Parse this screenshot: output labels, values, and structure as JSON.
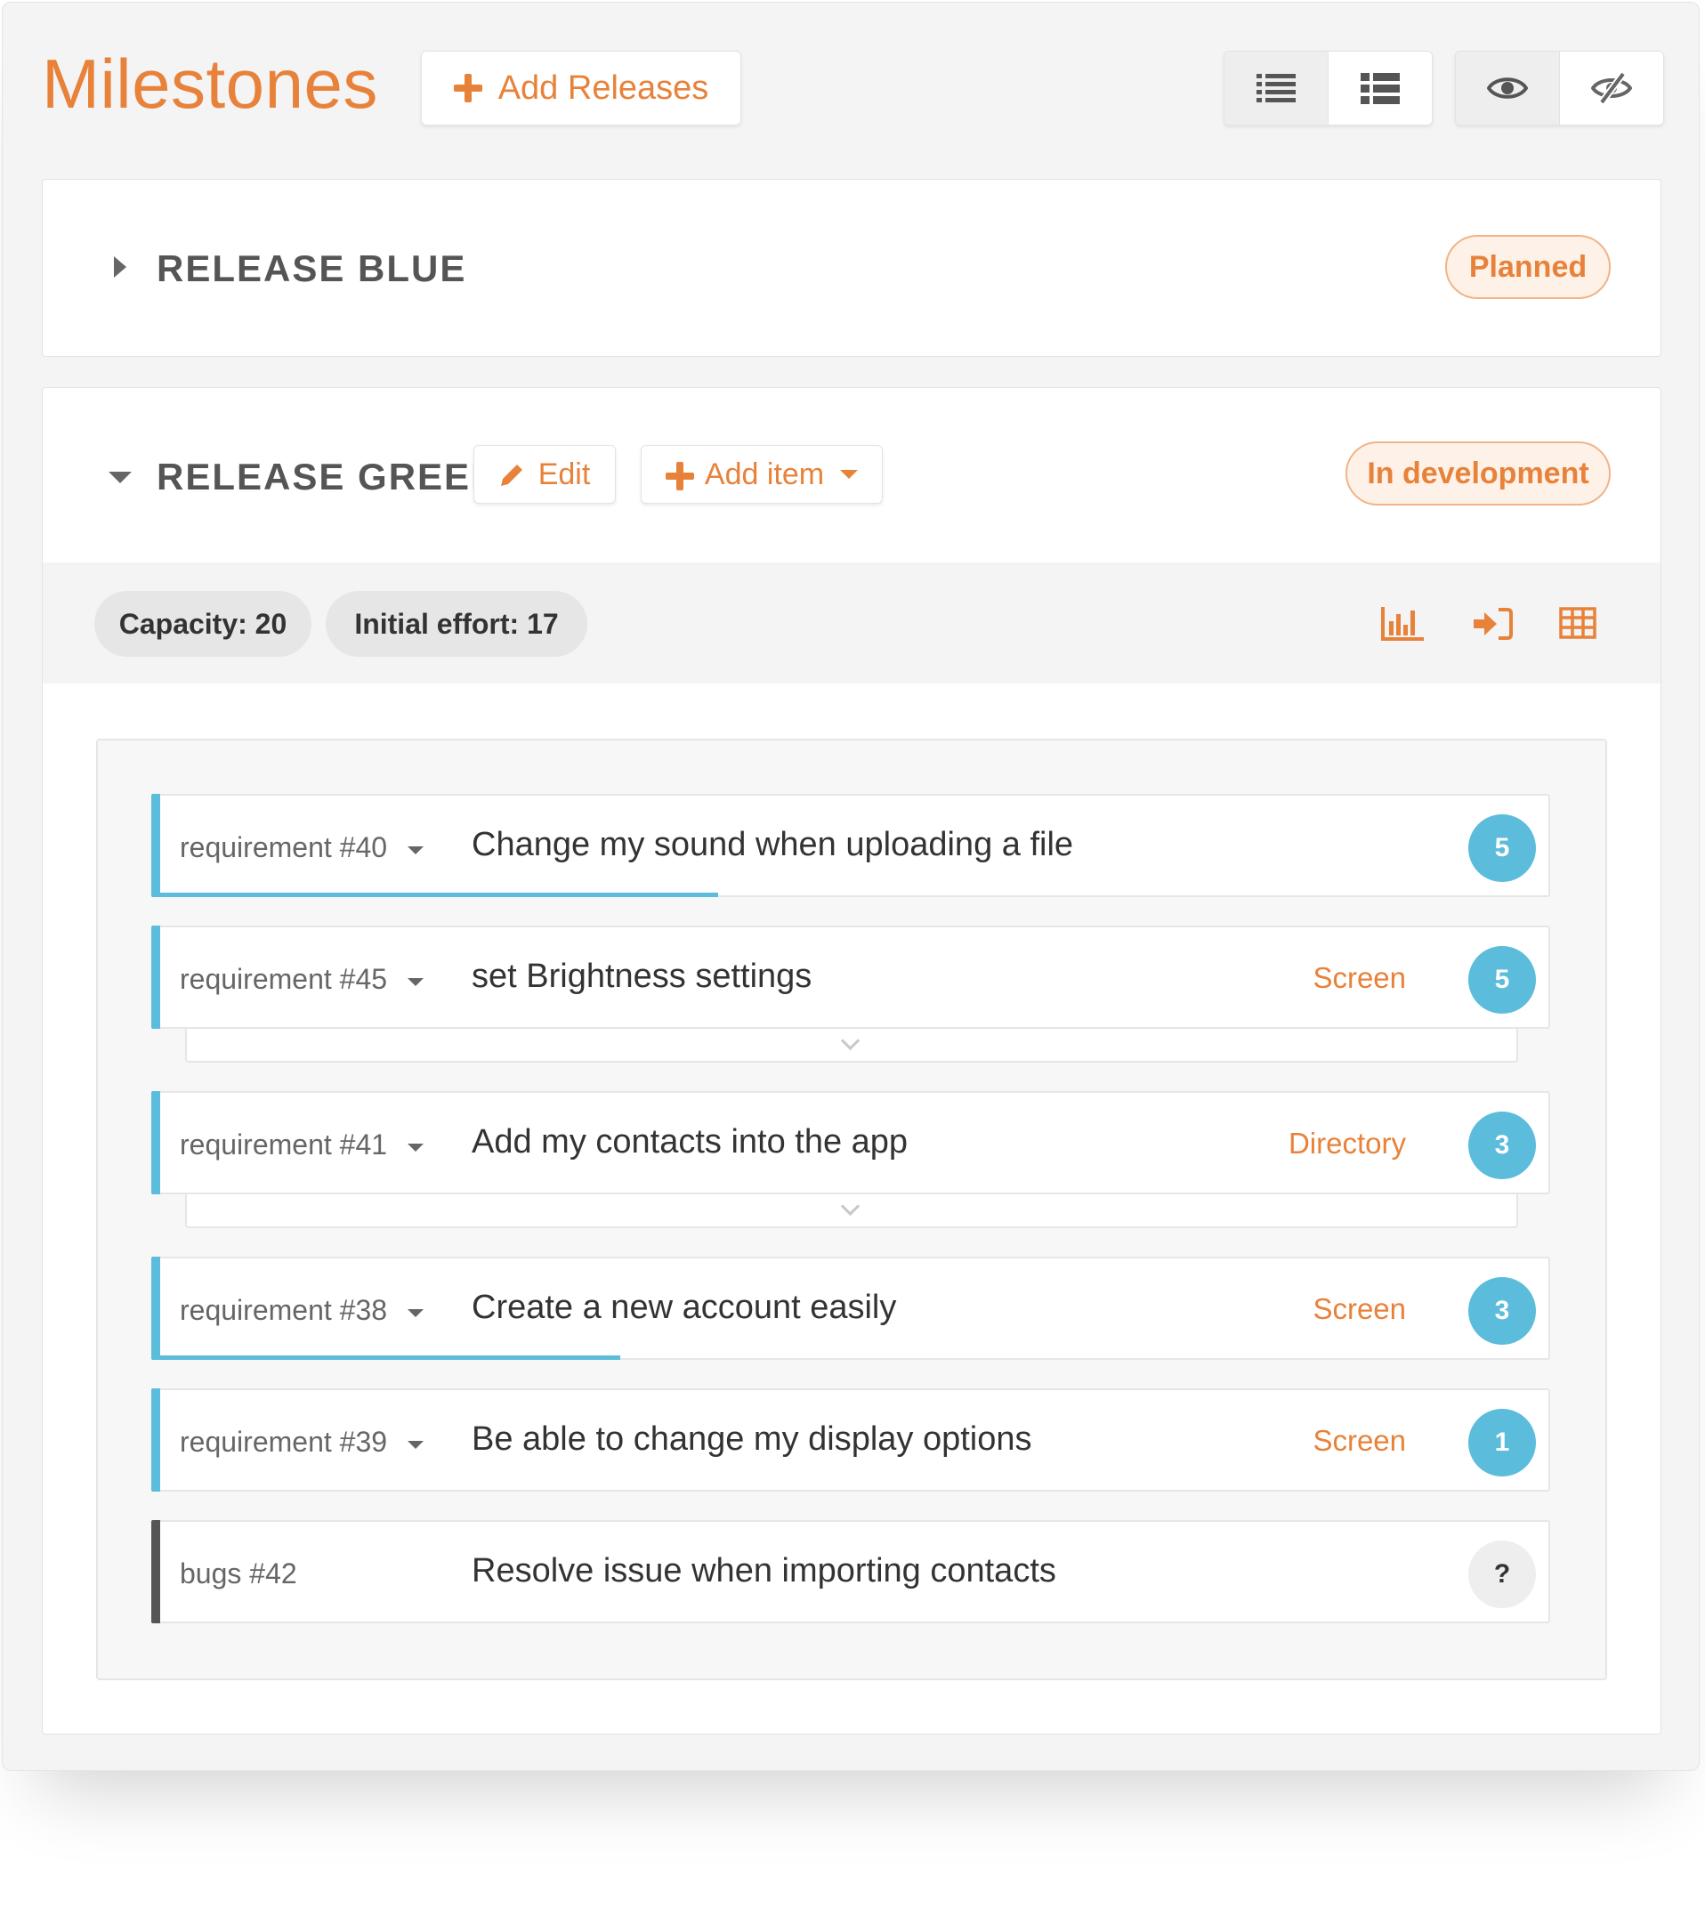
{
  "header": {
    "title": "Milestones",
    "add_releases_label": "Add Releases",
    "view_buttons": [
      {
        "icon": "list-icon",
        "state": "active"
      },
      {
        "icon": "detailed-list-icon",
        "state": "inactive"
      }
    ],
    "visibility_buttons": [
      {
        "icon": "eye-icon",
        "state": "active"
      },
      {
        "icon": "eye-slash-icon",
        "state": "inactive"
      }
    ]
  },
  "releases": [
    {
      "title": "RELEASE BLUE",
      "status": "Planned",
      "expanded": false
    },
    {
      "title": "RELEASE GREEN",
      "status": "In development",
      "expanded": true,
      "edit_label": "Edit",
      "add_item_label": "Add item",
      "capacity_label": "Capacity: 20",
      "initial_effort_label": "Initial effort: 17",
      "tools": [
        "chart-icon",
        "sign-in-icon",
        "table-icon"
      ],
      "items": [
        {
          "ref": "requirement #40",
          "name": "Change my sound when uploading a file",
          "tag": "",
          "effort": "5",
          "progress": 0.4
        },
        {
          "ref": "requirement #45",
          "name": "set Brightness settings",
          "tag": "Screen",
          "effort": "5",
          "progress": 0
        },
        {
          "ref": "requirement #41",
          "name": "Add my contacts into the app",
          "tag": "Directory",
          "effort": "3",
          "progress": 0
        },
        {
          "ref": "requirement #38",
          "name": "Create a new account easily",
          "tag": "Screen",
          "effort": "3",
          "progress": 0.33
        },
        {
          "ref": "requirement #39",
          "name": "Be able to change my display options",
          "tag": "Screen",
          "effort": "1",
          "progress": 0
        },
        {
          "ref": "bugs #42",
          "name": "Resolve issue when importing contacts",
          "tag": "",
          "effort": "?",
          "progress": 0
        }
      ]
    }
  ],
  "colors": {
    "accent": "#e8823a",
    "requirement": "#5bbcdb",
    "bug": "#555555"
  }
}
